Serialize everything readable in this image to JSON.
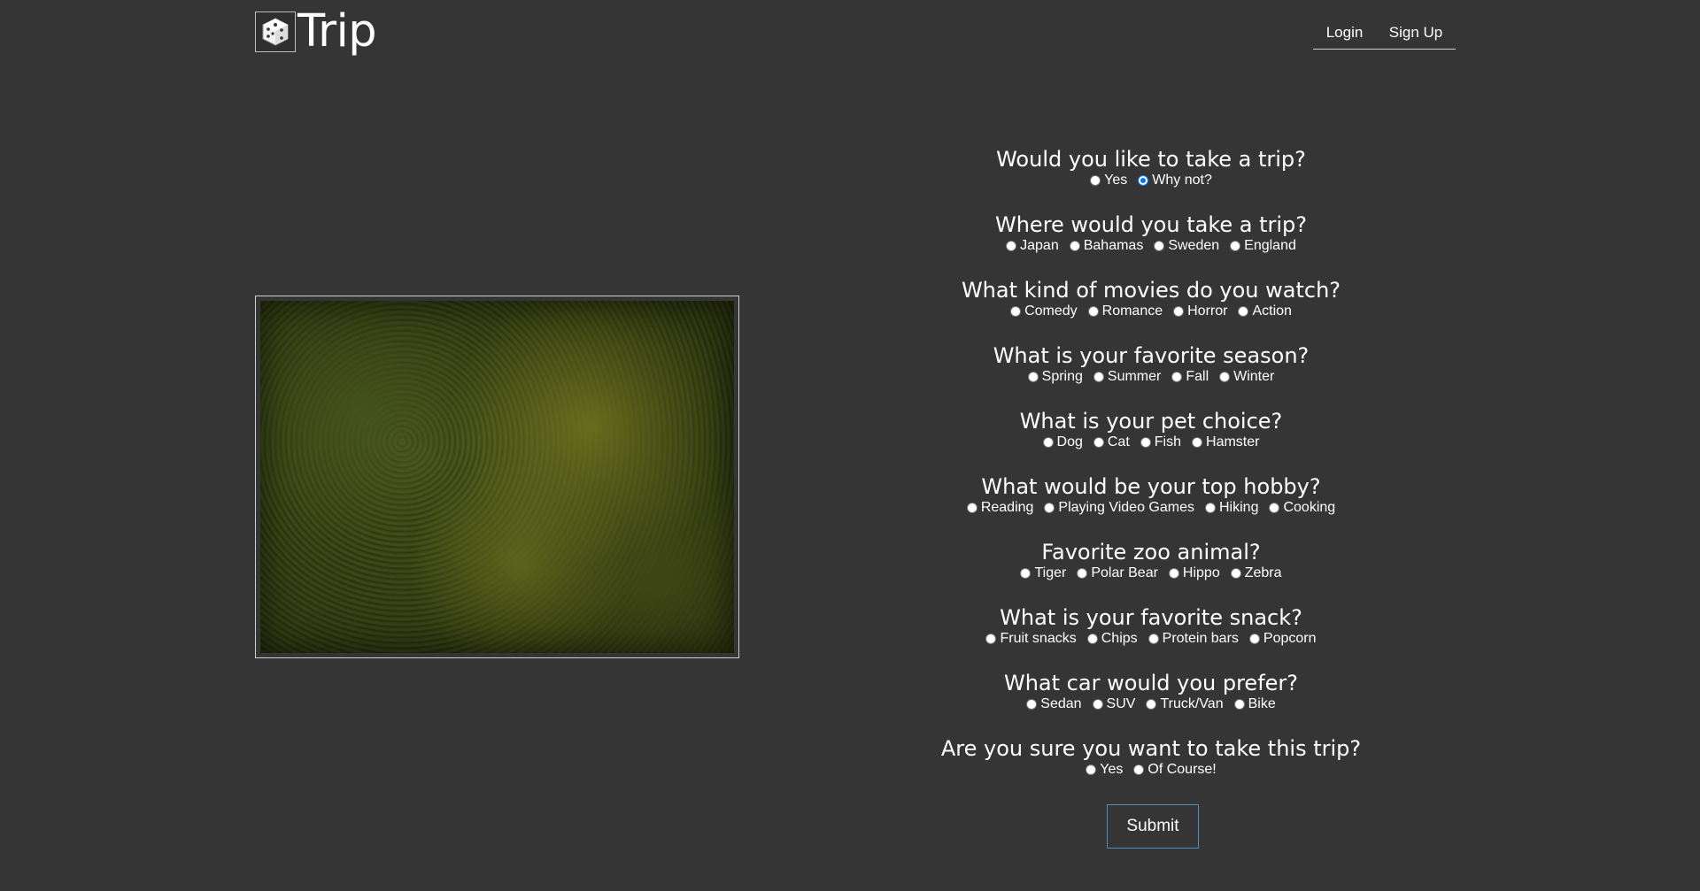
{
  "header": {
    "logo_text": "Trip",
    "logo_icon": "dice-icon",
    "nav": {
      "login": "Login",
      "signup": "Sign Up"
    }
  },
  "photo": {
    "description_icon": "forest-photo"
  },
  "questions": [
    {
      "title": "Would you like to take a trip?",
      "options": [
        "Yes",
        "Why not?"
      ],
      "selected": 1
    },
    {
      "title": "Where would you take a trip?",
      "options": [
        "Japan",
        "Bahamas",
        "Sweden",
        "England"
      ],
      "selected": null
    },
    {
      "title": "What kind of movies do you watch?",
      "options": [
        "Comedy",
        "Romance",
        "Horror",
        "Action"
      ],
      "selected": null
    },
    {
      "title": "What is your favorite season?",
      "options": [
        "Spring",
        "Summer",
        "Fall",
        "Winter"
      ],
      "selected": null
    },
    {
      "title": "What is your pet choice?",
      "options": [
        "Dog",
        "Cat",
        "Fish",
        "Hamster"
      ],
      "selected": null
    },
    {
      "title": "What would be your top hobby?",
      "options": [
        "Reading",
        "Playing Video Games",
        "Hiking",
        "Cooking"
      ],
      "selected": null
    },
    {
      "title": "Favorite zoo animal?",
      "options": [
        "Tiger",
        "Polar Bear",
        "Hippo",
        "Zebra"
      ],
      "selected": null
    },
    {
      "title": "What is your favorite snack?",
      "options": [
        "Fruit snacks",
        "Chips",
        "Protein bars",
        "Popcorn"
      ],
      "selected": null
    },
    {
      "title": "What car would you prefer?",
      "options": [
        "Sedan",
        "SUV",
        "Truck/Van",
        "Bike"
      ],
      "selected": null
    },
    {
      "title": "Are you sure you want to take this trip?",
      "options": [
        "Yes",
        "Of Course!"
      ],
      "selected": null
    }
  ],
  "submit_label": "Submit"
}
